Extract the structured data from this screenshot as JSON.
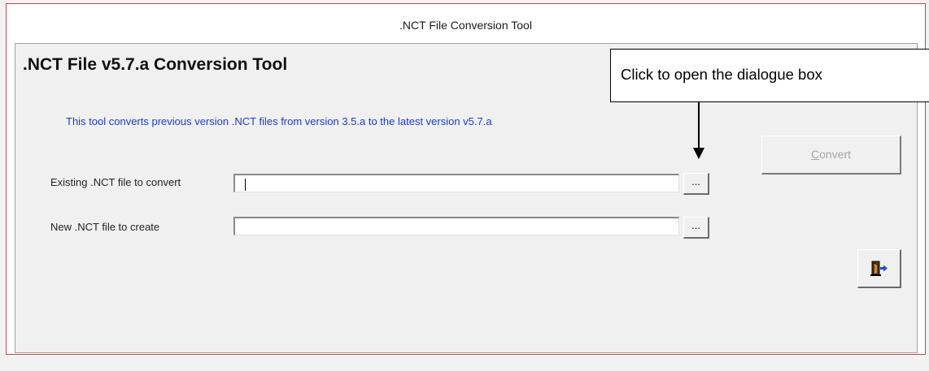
{
  "window": {
    "title": ".NCT File Conversion Tool"
  },
  "form": {
    "heading": ".NCT File v5.7.a Conversion Tool",
    "description": "This tool converts previous version .NCT files from version 3.5.a to the latest version v5.7.a",
    "help_icon": "help-question-icon",
    "fields": [
      {
        "label": "Existing .NCT file to convert",
        "value": "",
        "browse_label": "..."
      },
      {
        "label": "New .NCT file to create",
        "value": "",
        "browse_label": "..."
      }
    ],
    "convert_label_prefix": "",
    "convert_label_mnemonic": "C",
    "convert_label_rest": "onvert",
    "convert_enabled": false,
    "exit_icon": "exit-door-icon"
  },
  "annotation": {
    "text": "Click to open the dialogue box"
  },
  "colors": {
    "frame_border": "#c14747",
    "description_text": "#1d3bd1",
    "disabled_text": "#a6a6a6",
    "panel_background": "#f0f0f0"
  }
}
